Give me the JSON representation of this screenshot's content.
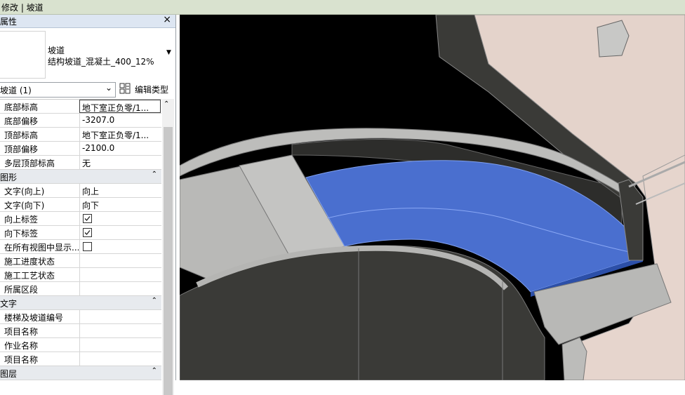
{
  "title_bar": {
    "text": "修改 | 坡道"
  },
  "properties": {
    "header": "属性",
    "close_glyph": "×",
    "type": {
      "family": "坡道",
      "name": "结构坡道_混凝土_400_12%"
    },
    "selector": {
      "label": "坡道 (1)"
    },
    "edit_type_label": "编辑类型",
    "rows_top": [
      {
        "label": "底部标高",
        "value": "地下室正负零/1..."
      },
      {
        "label": "底部偏移",
        "value": "-3207.0"
      },
      {
        "label": "顶部标高",
        "value": "地下室正负零/1..."
      },
      {
        "label": "顶部偏移",
        "value": "-2100.0"
      },
      {
        "label": "多层顶部标高",
        "value": "无"
      }
    ],
    "group_graphics": "图形",
    "rows_graphics": [
      {
        "label": "文字(向上)",
        "value": "向上"
      },
      {
        "label": "文字(向下)",
        "value": "向下"
      },
      {
        "label": "向上标签",
        "checked": true
      },
      {
        "label": "向下标签",
        "checked": true
      },
      {
        "label": "在所有视图中显示...",
        "checked": false
      },
      {
        "label": "施工进度状态",
        "value": ""
      },
      {
        "label": "施工工艺状态",
        "value": ""
      },
      {
        "label": "所属区段",
        "value": ""
      }
    ],
    "group_text": "文字",
    "rows_text": [
      {
        "label": "楼梯及坡道编号",
        "value": ""
      },
      {
        "label": "项目名称",
        "value": ""
      },
      {
        "label": "作业名称",
        "value": ""
      },
      {
        "label": "项目名称",
        "value": ""
      }
    ],
    "group_layers": "图层"
  },
  "colors": {
    "selection_blue": "#4a6fcf",
    "wall_dark": "#3a3a37",
    "slab_pink": "#e4d3cb"
  }
}
